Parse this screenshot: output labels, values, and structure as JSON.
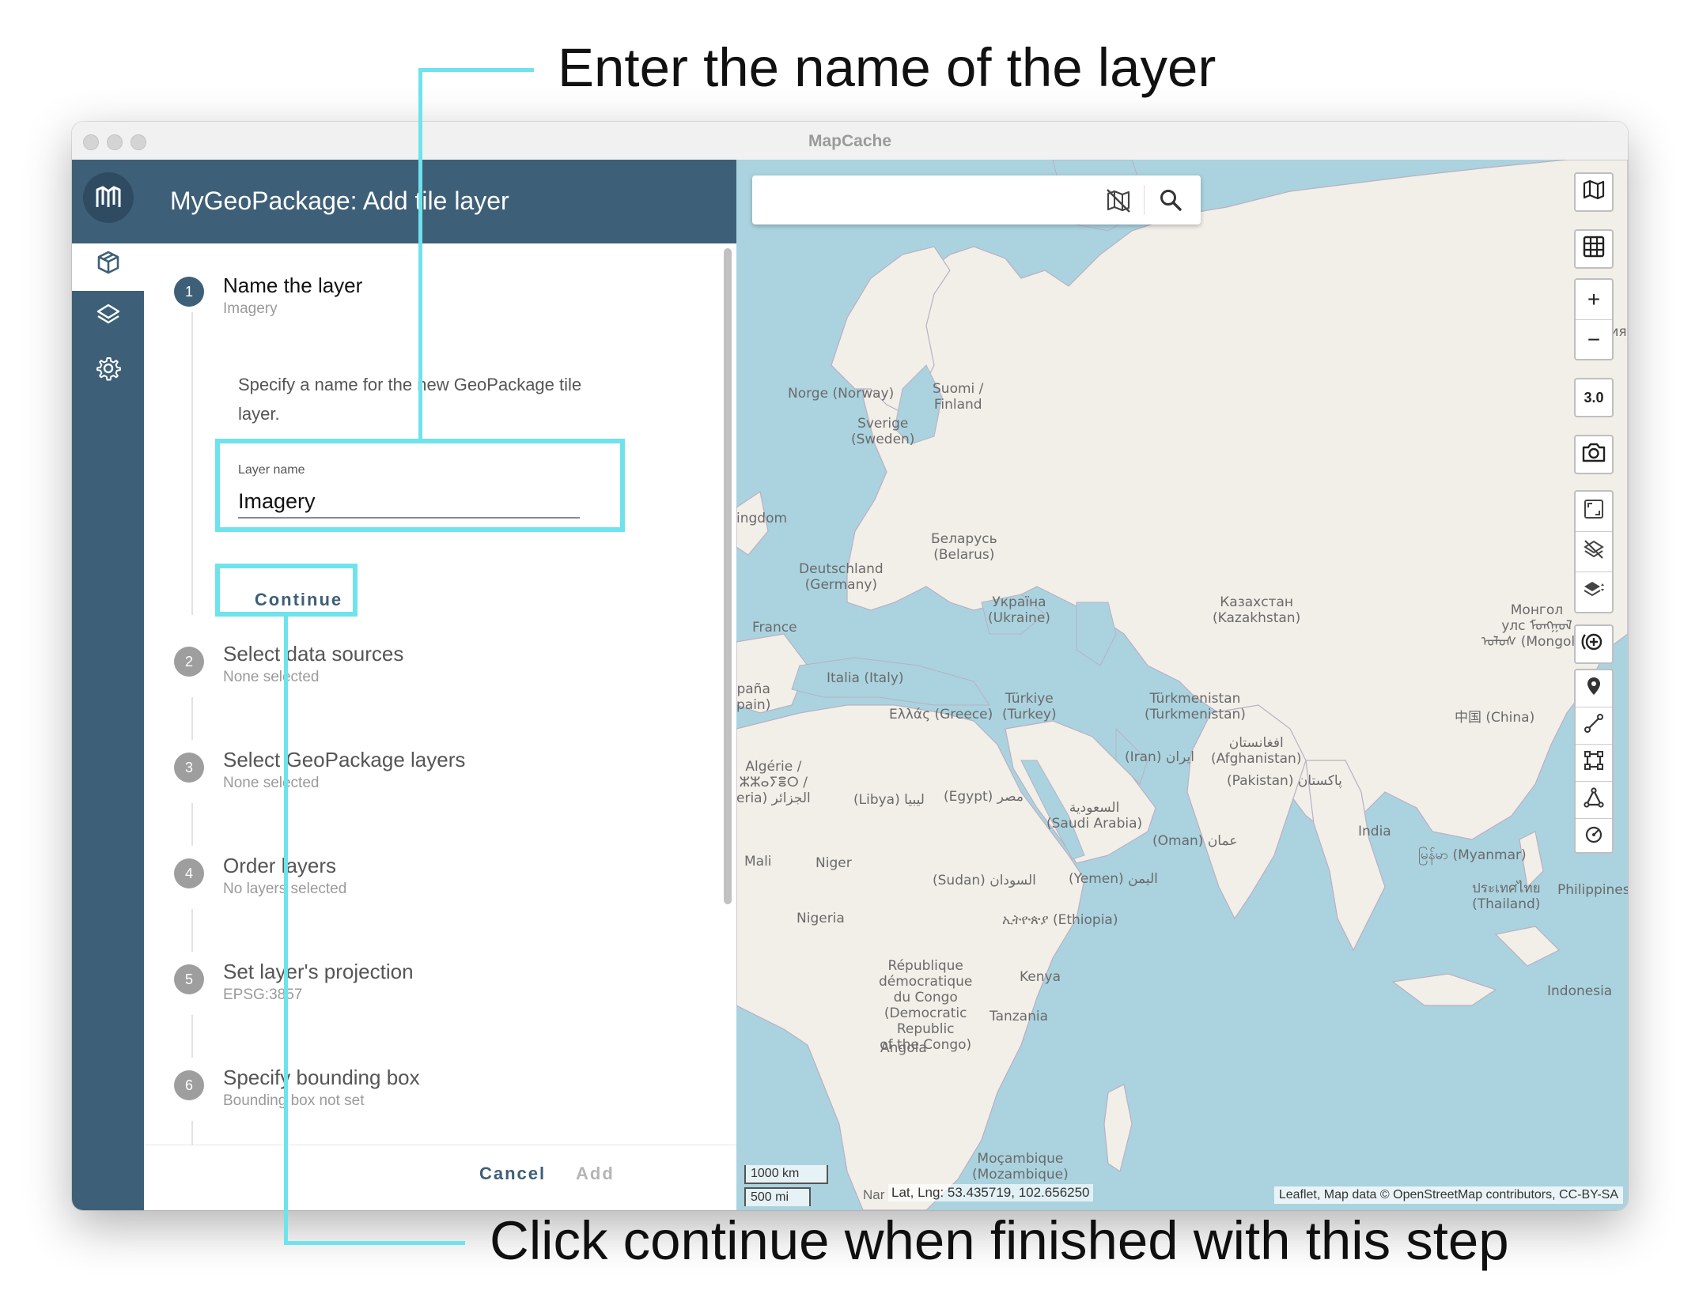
{
  "annotations": {
    "top_text": "Enter the name of the layer",
    "bottom_text": "Click continue when finished with this step",
    "accent_color": "#6ee3ec"
  },
  "window": {
    "title": "MapCache"
  },
  "nav": {
    "icons": [
      "mapcache-logo-icon",
      "geopackage-icon",
      "layers-icon",
      "settings-icon"
    ]
  },
  "panel": {
    "title": "MyGeoPackage: Add tile layer",
    "steps": [
      {
        "number": "1",
        "title": "Name the layer",
        "subtitle": "Imagery"
      },
      {
        "number": "2",
        "title": "Select data sources",
        "subtitle": "None selected"
      },
      {
        "number": "3",
        "title": "Select GeoPackage layers",
        "subtitle": "None selected"
      },
      {
        "number": "4",
        "title": "Order layers",
        "subtitle": "No layers selected"
      },
      {
        "number": "5",
        "title": "Set layer's projection",
        "subtitle": "EPSG:3857"
      },
      {
        "number": "6",
        "title": "Specify bounding box",
        "subtitle": "Bounding box not set"
      }
    ],
    "step1_description": "Specify a name for the new GeoPackage tile layer.",
    "layer_name_label": "Layer name",
    "layer_name_value": "Imagery",
    "continue_label": "Continue",
    "cancel_label": "Cancel",
    "add_label": "Add",
    "brand_color": "#3e5f78"
  },
  "map": {
    "search_placeholder": "",
    "zoom_level": "3.0",
    "scale_km": "1000 km",
    "scale_mi": "500 mi",
    "latlng": "Lat, Lng: 53.435719, 102.656250",
    "latlng_prefix": "Nar",
    "attribution": "Leaflet, Map data © OpenStreetMap contributors, CC-BY-SA",
    "labels": [
      {
        "id": "norway",
        "text": "Norge (Norway)"
      },
      {
        "id": "finland",
        "text": "Suomi /\nFinland"
      },
      {
        "id": "sweden",
        "text": "Sverige\n(Sweden)"
      },
      {
        "id": "russia",
        "text": "Россия\n(Ru"
      },
      {
        "id": "uk",
        "text": "ingdom"
      },
      {
        "id": "belarus",
        "text": "Беларусь\n(Belarus)"
      },
      {
        "id": "germany",
        "text": "Deutschland\n(Germany)"
      },
      {
        "id": "ukraine",
        "text": "Україна\n(Ukraine)"
      },
      {
        "id": "kazakhstan",
        "text": "Казахстан\n(Kazakhstan)"
      },
      {
        "id": "mongolia",
        "text": "Монгол\nулс ᠮᠣᠩᠭᠣᠯ\nᠤᠯᠤᠰ (Mongolia)"
      },
      {
        "id": "france",
        "text": "France"
      },
      {
        "id": "spain",
        "text": "paña\npain)"
      },
      {
        "id": "italy",
        "text": "Italia (Italy)"
      },
      {
        "id": "turkey",
        "text": "Türkiye\n(Turkey)"
      },
      {
        "id": "greece",
        "text": "Ελλάς (Greece)"
      },
      {
        "id": "turkmenistan",
        "text": "Türkmenistan\n(Turkmenistan)"
      },
      {
        "id": "china",
        "text": "中国 (China)"
      },
      {
        "id": "afghanistan",
        "text": "افغانستان\n(Afghanistan)"
      },
      {
        "id": "iran",
        "text": "(Iran) ایران"
      },
      {
        "id": "pakistan",
        "text": "(Pakistan) پاکستان"
      },
      {
        "id": "algeria",
        "text": "Algérie /\nⵣⵣⴰⵢⴻⵔ /\neria) الجزائر"
      },
      {
        "id": "libya",
        "text": "(Libya) ليبيا"
      },
      {
        "id": "egypt",
        "text": "(Egypt) مصر"
      },
      {
        "id": "saudi",
        "text": "السعودية\n(Saudi Arabia)"
      },
      {
        "id": "india",
        "text": "India"
      },
      {
        "id": "oman",
        "text": "(Oman) عمان"
      },
      {
        "id": "myanmar",
        "text": "မြန်မာ (Myanmar)"
      },
      {
        "id": "mali",
        "text": "Mali"
      },
      {
        "id": "niger",
        "text": "Niger"
      },
      {
        "id": "sudan",
        "text": "(Sudan) السودان"
      },
      {
        "id": "yemen",
        "text": "(Yemen) اليمن"
      },
      {
        "id": "thailand",
        "text": "ประเทศไทย\n(Thailand)"
      },
      {
        "id": "philippines",
        "text": "Philippines"
      },
      {
        "id": "nigeria",
        "text": "Nigeria"
      },
      {
        "id": "ethiopia",
        "text": "ኢትዮጵያ (Ethiopia)"
      },
      {
        "id": "drc",
        "text": "République\ndémocratique\ndu Congo\n(Democratic\nRepublic\nof the Congo)"
      },
      {
        "id": "kenya",
        "text": "Kenya"
      },
      {
        "id": "indonesia",
        "text": "Indonesia"
      },
      {
        "id": "tanzania",
        "text": "Tanzania"
      },
      {
        "id": "angola",
        "text": "Angola"
      },
      {
        "id": "mozambique",
        "text": "Moçambique\n(Mozambique)"
      }
    ]
  }
}
